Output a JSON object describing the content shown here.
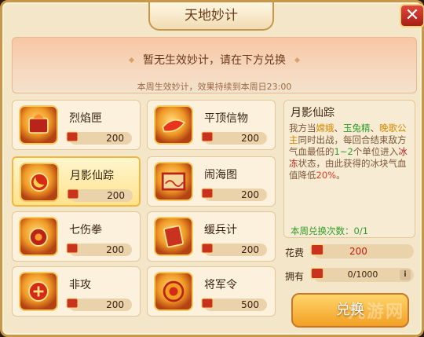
{
  "window": {
    "title": "天地妙计",
    "close_label": "✕"
  },
  "banner": {
    "status": "暂无生效妙计，请在下方兑换",
    "note": "本周生效妙计，效果持续到本周日23:00"
  },
  "items": [
    {
      "name": "烈焰匣",
      "cost": "200",
      "icon": "flame-box-icon"
    },
    {
      "name": "平顶信物",
      "cost": "200",
      "icon": "token-icon"
    },
    {
      "name": "月影仙踪",
      "cost": "200",
      "icon": "moon-shadow-icon",
      "selected": true
    },
    {
      "name": "闹海图",
      "cost": "200",
      "icon": "sea-map-icon"
    },
    {
      "name": "七伤拳",
      "cost": "200",
      "icon": "fist-icon"
    },
    {
      "name": "缓兵计",
      "cost": "200",
      "icon": "scroll-icon"
    },
    {
      "name": "非攻",
      "cost": "200",
      "icon": "peace-icon"
    },
    {
      "name": "将军令",
      "cost": "500",
      "icon": "general-order-icon"
    }
  ],
  "detail": {
    "title": "月影仙踪",
    "desc_1": "我方当",
    "desc_hl1": "嫦娥",
    "desc_2": "、",
    "desc_hl2": "玉兔精",
    "desc_3": "、",
    "desc_hl3": "晚歌公主",
    "desc_4": "同时出战，每回合结束敌方气血最低的",
    "desc_hl4": "1~2",
    "desc_5": "个单位进入",
    "desc_hl5": "冰冻",
    "desc_6": "状态，由此获得的冰块气血值降低",
    "desc_hl6": "20%",
    "desc_7": "。",
    "count": "本周兑换次数：0/1"
  },
  "cost_row": {
    "label": "花费",
    "value": "200"
  },
  "own_row": {
    "label": "拥有",
    "value": "0/1000",
    "info": "i"
  },
  "exchange_label": "兑换",
  "watermark": "九游网",
  "colors": {
    "accent": "#f2a024",
    "border": "#c9974a",
    "highlight_green": "#2f9c27"
  }
}
